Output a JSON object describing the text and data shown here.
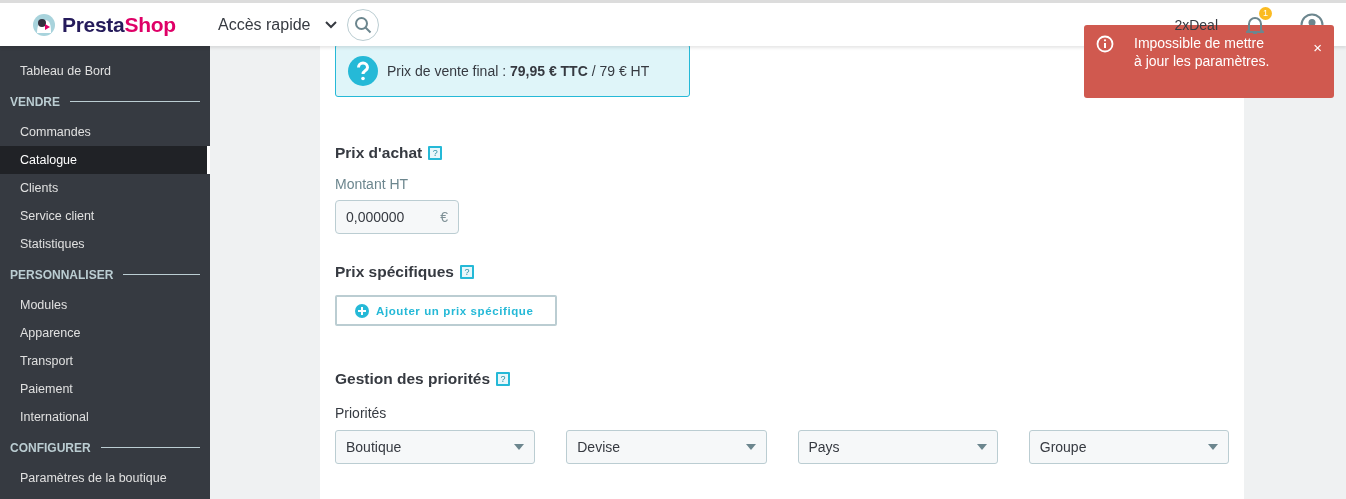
{
  "header": {
    "logo": [
      {
        "text": "Presta",
        "color": "#251b5b"
      },
      {
        "text": "Shop",
        "color": "#df0067"
      }
    ],
    "quick_access": "Accès rapide",
    "shop_name": "2xDeal",
    "notification_count": "1"
  },
  "sidebar": {
    "items": [
      {
        "kind": "link",
        "label": "Tableau de Bord",
        "selected": false
      },
      {
        "kind": "section",
        "label": "VENDRE"
      },
      {
        "kind": "link",
        "label": "Commandes",
        "selected": false
      },
      {
        "kind": "link",
        "label": "Catalogue",
        "selected": true
      },
      {
        "kind": "link",
        "label": "Clients",
        "selected": false
      },
      {
        "kind": "link",
        "label": "Service client",
        "selected": false
      },
      {
        "kind": "link",
        "label": "Statistiques",
        "selected": false
      },
      {
        "kind": "section",
        "label": "PERSONNALISER"
      },
      {
        "kind": "link",
        "label": "Modules",
        "selected": false
      },
      {
        "kind": "link",
        "label": "Apparence",
        "selected": false
      },
      {
        "kind": "link",
        "label": "Transport",
        "selected": false
      },
      {
        "kind": "link",
        "label": "Paiement",
        "selected": false
      },
      {
        "kind": "link",
        "label": "International",
        "selected": false
      },
      {
        "kind": "section",
        "label": "CONFIGURER"
      },
      {
        "kind": "link",
        "label": "Paramètres de la boutique",
        "selected": false
      }
    ]
  },
  "info": {
    "text": "Prix de vente final : **79,95 € TTC** / 79 € HT"
  },
  "purchase": {
    "title": "Prix d'achat",
    "help": "?",
    "label": "Montant HT",
    "value": "0,000000",
    "currency": "€"
  },
  "specific": {
    "title": "Prix spécifiques",
    "help": "?",
    "button": "Ajouter un prix spécifique"
  },
  "priorities": {
    "title": "Gestion des priorités",
    "help": "?",
    "label": "Priorités",
    "selects": [
      "Boutique",
      "Devise",
      "Pays",
      "Groupe"
    ]
  },
  "toast": {
    "message": "Impossible de mettre à jour les paramètres.",
    "close": "×"
  }
}
